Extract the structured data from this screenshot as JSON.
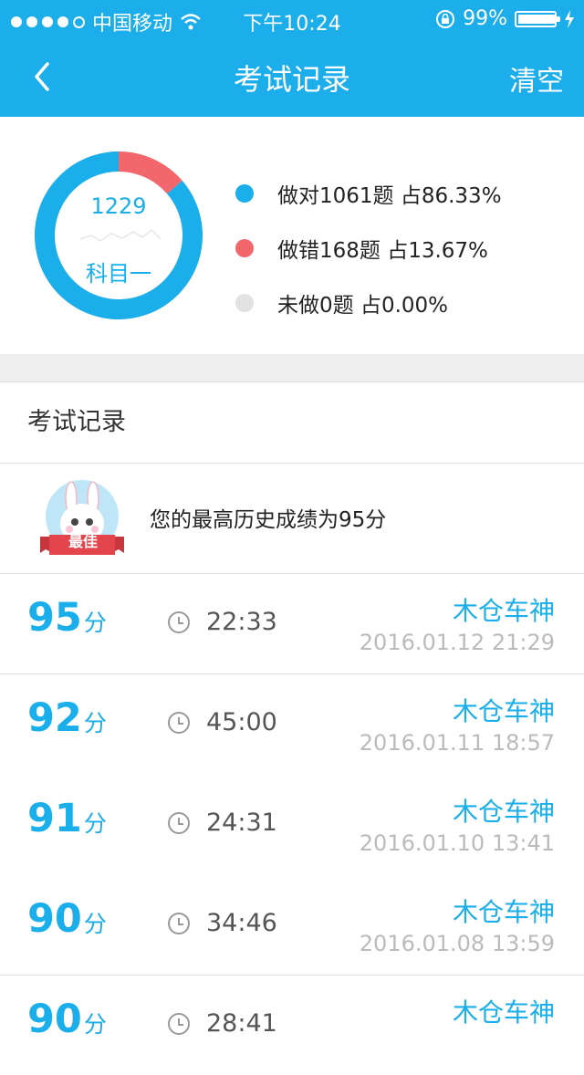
{
  "status_bar": {
    "carrier": "中国移动",
    "time": "下午10:24",
    "battery_text": "99%",
    "battery_level": 0.99,
    "icons": [
      "signal-dots-icon",
      "wifi-icon",
      "orientation-lock-icon",
      "battery-icon",
      "charging-icon"
    ]
  },
  "nav": {
    "back_icon": "chevron-left-icon",
    "title": "考试记录",
    "clear_label": "清空"
  },
  "summary": {
    "total": "1229",
    "subject": "科目一",
    "legend": [
      {
        "label": "做对1061题 占86.33%",
        "color": "#1aaeea"
      },
      {
        "label": "做错168题 占13.67%",
        "color": "#f1676b"
      },
      {
        "label": "未做0题 占0.00%",
        "color": "#e2e2e2"
      }
    ]
  },
  "chart_data": {
    "type": "pie",
    "categories": [
      "做对",
      "做错",
      "未做"
    ],
    "values": [
      1061,
      168,
      0
    ],
    "colors": [
      "#1aaeea",
      "#f1676b",
      "#e2e2e2"
    ],
    "title": "",
    "center_text": [
      "1229",
      "科目一"
    ]
  },
  "records_section": {
    "title": "考试记录",
    "best_badge": "最佳",
    "best_text": "您的最高历史成绩为95分"
  },
  "records": [
    {
      "score": "95",
      "unit": "分",
      "duration": "22:33",
      "name": "木仓车神",
      "date": "2016.01.12 21:29"
    },
    {
      "score": "92",
      "unit": "分",
      "duration": "45:00",
      "name": "木仓车神",
      "date": "2016.01.11 18:57"
    },
    {
      "score": "91",
      "unit": "分",
      "duration": "24:31",
      "name": "木仓车神",
      "date": "2016.01.10 13:41"
    },
    {
      "score": "90",
      "unit": "分",
      "duration": "34:46",
      "name": "木仓车神",
      "date": "2016.01.08 13:59"
    },
    {
      "score": "90",
      "unit": "分",
      "duration": "28:41",
      "name": "木仓车神",
      "date": ""
    }
  ]
}
